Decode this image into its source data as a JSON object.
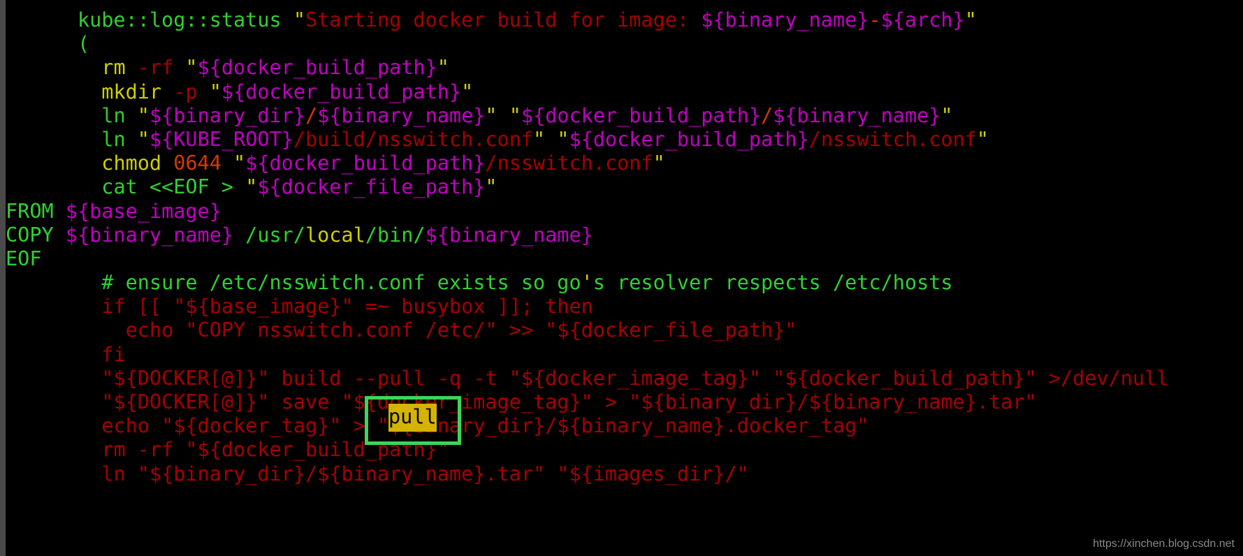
{
  "terminal": {
    "background_color": "#000000",
    "gutter_color": "#4a4a4a",
    "font_size_px": 28.5,
    "line_height_px": 34.2
  },
  "palette": {
    "green": "#2fd12f",
    "yellow": "#cfcf00",
    "magenta": "#c000c0",
    "red": "#a60000",
    "orange": "#d43a00",
    "annotation_box": "#3cd45c",
    "highlight_background": "#d4b400",
    "highlight_text": "#000000",
    "watermark": "#8a8a8a"
  },
  "annotation": {
    "box_label": "green-rectangle-around-pull-flag",
    "highlighted_word": "pull"
  },
  "watermark": {
    "text": "https://xinchen.blog.csdn.net"
  },
  "lines": [
    {
      "id": 1,
      "text": "      kube::log::status \"Starting docker build for image: ${binary_name}-${arch}\"",
      "tokens": [
        {
          "t": "      ",
          "c": "c-plain"
        },
        {
          "t": "kube::log::status ",
          "c": "c-green"
        },
        {
          "t": "\"",
          "c": "c-quote"
        },
        {
          "t": "Starting docker build for image: ",
          "c": "c-red"
        },
        {
          "t": "${binary_name}",
          "c": "c-magenta"
        },
        {
          "t": "-",
          "c": "c-orange"
        },
        {
          "t": "${arch}",
          "c": "c-magenta"
        },
        {
          "t": "\"",
          "c": "c-quote"
        }
      ]
    },
    {
      "id": 2,
      "text": "      (",
      "tokens": [
        {
          "t": "      ",
          "c": "c-plain"
        },
        {
          "t": "(",
          "c": "c-green"
        }
      ]
    },
    {
      "id": 3,
      "text": "        rm -rf \"${docker_build_path}\"",
      "tokens": [
        {
          "t": "        ",
          "c": "c-plain"
        },
        {
          "t": "rm ",
          "c": "c-yellow"
        },
        {
          "t": "-rf ",
          "c": "c-red"
        },
        {
          "t": "\"",
          "c": "c-quote"
        },
        {
          "t": "${docker_build_path}",
          "c": "c-magenta"
        },
        {
          "t": "\"",
          "c": "c-quote"
        }
      ]
    },
    {
      "id": 4,
      "text": "        mkdir -p \"${docker_build_path}\"",
      "tokens": [
        {
          "t": "        ",
          "c": "c-plain"
        },
        {
          "t": "mkdir ",
          "c": "c-yellow"
        },
        {
          "t": "-p ",
          "c": "c-red"
        },
        {
          "t": "\"",
          "c": "c-quote"
        },
        {
          "t": "${docker_build_path}",
          "c": "c-magenta"
        },
        {
          "t": "\"",
          "c": "c-quote"
        }
      ]
    },
    {
      "id": 5,
      "text": "        ln \"${binary_dir}/${binary_name}\" \"${docker_build_path}/${binary_name}\"",
      "tokens": [
        {
          "t": "        ",
          "c": "c-plain"
        },
        {
          "t": "ln ",
          "c": "c-green"
        },
        {
          "t": "\"",
          "c": "c-quote"
        },
        {
          "t": "${binary_dir}",
          "c": "c-magenta"
        },
        {
          "t": "/",
          "c": "c-orange"
        },
        {
          "t": "${binary_name}",
          "c": "c-magenta"
        },
        {
          "t": "\" \"",
          "c": "c-quote"
        },
        {
          "t": "${docker_build_path}",
          "c": "c-magenta"
        },
        {
          "t": "/",
          "c": "c-orange"
        },
        {
          "t": "${binary_name}",
          "c": "c-magenta"
        },
        {
          "t": "\"",
          "c": "c-quote"
        }
      ]
    },
    {
      "id": 6,
      "text": "        ln \"${KUBE_ROOT}/build/nsswitch.conf\" \"${docker_build_path}/nsswitch.conf\"",
      "tokens": [
        {
          "t": "        ",
          "c": "c-plain"
        },
        {
          "t": "ln ",
          "c": "c-green"
        },
        {
          "t": "\"",
          "c": "c-quote"
        },
        {
          "t": "${KUBE_ROOT}",
          "c": "c-magenta"
        },
        {
          "t": "/build/nsswitch.conf",
          "c": "c-red"
        },
        {
          "t": "\" \"",
          "c": "c-quote"
        },
        {
          "t": "${docker_build_path}",
          "c": "c-magenta"
        },
        {
          "t": "/nsswitch.conf",
          "c": "c-red"
        },
        {
          "t": "\"",
          "c": "c-quote"
        }
      ]
    },
    {
      "id": 7,
      "text": "        chmod 0644 \"${docker_build_path}/nsswitch.conf\"",
      "tokens": [
        {
          "t": "        ",
          "c": "c-plain"
        },
        {
          "t": "chmod ",
          "c": "c-yellow"
        },
        {
          "t": "0644 ",
          "c": "c-orange"
        },
        {
          "t": "\"",
          "c": "c-quote"
        },
        {
          "t": "${docker_build_path}",
          "c": "c-magenta"
        },
        {
          "t": "/nsswitch.conf",
          "c": "c-red"
        },
        {
          "t": "\"",
          "c": "c-quote"
        }
      ]
    },
    {
      "id": 8,
      "text": "        cat <<EOF > \"${docker_file_path}\"",
      "tokens": [
        {
          "t": "        ",
          "c": "c-plain"
        },
        {
          "t": "cat <<EOF > ",
          "c": "c-green"
        },
        {
          "t": "\"",
          "c": "c-quote"
        },
        {
          "t": "${docker_file_path}",
          "c": "c-magenta"
        },
        {
          "t": "\"",
          "c": "c-quote"
        }
      ]
    },
    {
      "id": 9,
      "text": "FROM ${base_image}",
      "tokens": [
        {
          "t": "FROM ",
          "c": "c-green"
        },
        {
          "t": "${base_image}",
          "c": "c-magenta"
        }
      ]
    },
    {
      "id": 10,
      "text": "COPY ${binary_name} /usr/local/bin/${binary_name}",
      "tokens": [
        {
          "t": "COPY ",
          "c": "c-green"
        },
        {
          "t": "${binary_name}",
          "c": "c-magenta"
        },
        {
          "t": " /usr/",
          "c": "c-green"
        },
        {
          "t": "local",
          "c": "c-yellow"
        },
        {
          "t": "/bin/",
          "c": "c-green"
        },
        {
          "t": "${binary_name}",
          "c": "c-magenta"
        }
      ]
    },
    {
      "id": 11,
      "text": "EOF",
      "tokens": [
        {
          "t": "EOF",
          "c": "c-green"
        }
      ]
    },
    {
      "id": 12,
      "text": "        # ensure /etc/nsswitch.conf exists so go's resolver respects /etc/hosts",
      "tokens": [
        {
          "t": "        ",
          "c": "c-plain"
        },
        {
          "t": "# ensure /etc/nsswitch.conf exists so go",
          "c": "c-green"
        },
        {
          "t": "'",
          "c": "c-yellow"
        },
        {
          "t": "s resolver respects /etc/hosts",
          "c": "c-green"
        }
      ]
    },
    {
      "id": 13,
      "text": "        if [[ \"${base_image}\" =~ busybox ]]; then",
      "tokens": [
        {
          "t": "        ",
          "c": "c-plain"
        },
        {
          "t": "if [[ ",
          "c": "c-red"
        },
        {
          "t": "\"",
          "c": "c-red"
        },
        {
          "t": "${base_image}",
          "c": "c-red"
        },
        {
          "t": "\"",
          "c": "c-red"
        },
        {
          "t": " =~ busybox ]]; then",
          "c": "c-red"
        }
      ]
    },
    {
      "id": 14,
      "text": "          echo \"COPY nsswitch.conf /etc/\" >> \"${docker_file_path}\"",
      "tokens": [
        {
          "t": "          ",
          "c": "c-plain"
        },
        {
          "t": "echo \"COPY nsswitch.conf /etc/\" >> \"${docker_file_path}\"",
          "c": "c-red"
        }
      ]
    },
    {
      "id": 15,
      "text": "        fi",
      "tokens": [
        {
          "t": "        ",
          "c": "c-plain"
        },
        {
          "t": "fi",
          "c": "c-red"
        }
      ]
    },
    {
      "id": 16,
      "text": "        \"${DOCKER[@]}\" build --pull -q -t \"${docker_image_tag}\" \"${docker_build_path}\" >/dev/null",
      "tokens": [
        {
          "t": "        ",
          "c": "c-plain"
        },
        {
          "t": "\"${DOCKER[@]}\" build --pull -q -t \"${docker_image_tag}\" \"${docker_build_path}\" >/dev/null",
          "c": "c-red"
        }
      ]
    },
    {
      "id": 17,
      "text": "        \"${DOCKER[@]}\" save \"${docker_image_tag}\" > \"${binary_dir}/${binary_name}.tar\"",
      "tokens": [
        {
          "t": "        ",
          "c": "c-plain"
        },
        {
          "t": "\"${DOCKER[@]}\" save \"${docker_image_tag}\" > \"${binary_dir}/${binary_name}.tar\"",
          "c": "c-red"
        }
      ]
    },
    {
      "id": 18,
      "text": "        echo \"${docker_tag}\" > \"${binary_dir}/${binary_name}.docker_tag\"",
      "tokens": [
        {
          "t": "        ",
          "c": "c-plain"
        },
        {
          "t": "echo \"${docker_tag}\" > \"${binary_dir}/${binary_name}.docker_tag\"",
          "c": "c-red"
        }
      ]
    },
    {
      "id": 19,
      "text": "        rm -rf \"${docker_build_path}\"",
      "tokens": [
        {
          "t": "        ",
          "c": "c-plain"
        },
        {
          "t": "rm -rf \"${docker_build_path}\"",
          "c": "c-red"
        }
      ]
    },
    {
      "id": 20,
      "text": "        ln \"${binary_dir}/${binary_name}.tar\" \"${images_dir}/\"",
      "tokens": [
        {
          "t": "        ",
          "c": "c-plain"
        },
        {
          "t": "ln \"${binary_dir}/${binary_name}.tar\" \"${images_dir}/\"",
          "c": "c-red"
        }
      ]
    }
  ]
}
